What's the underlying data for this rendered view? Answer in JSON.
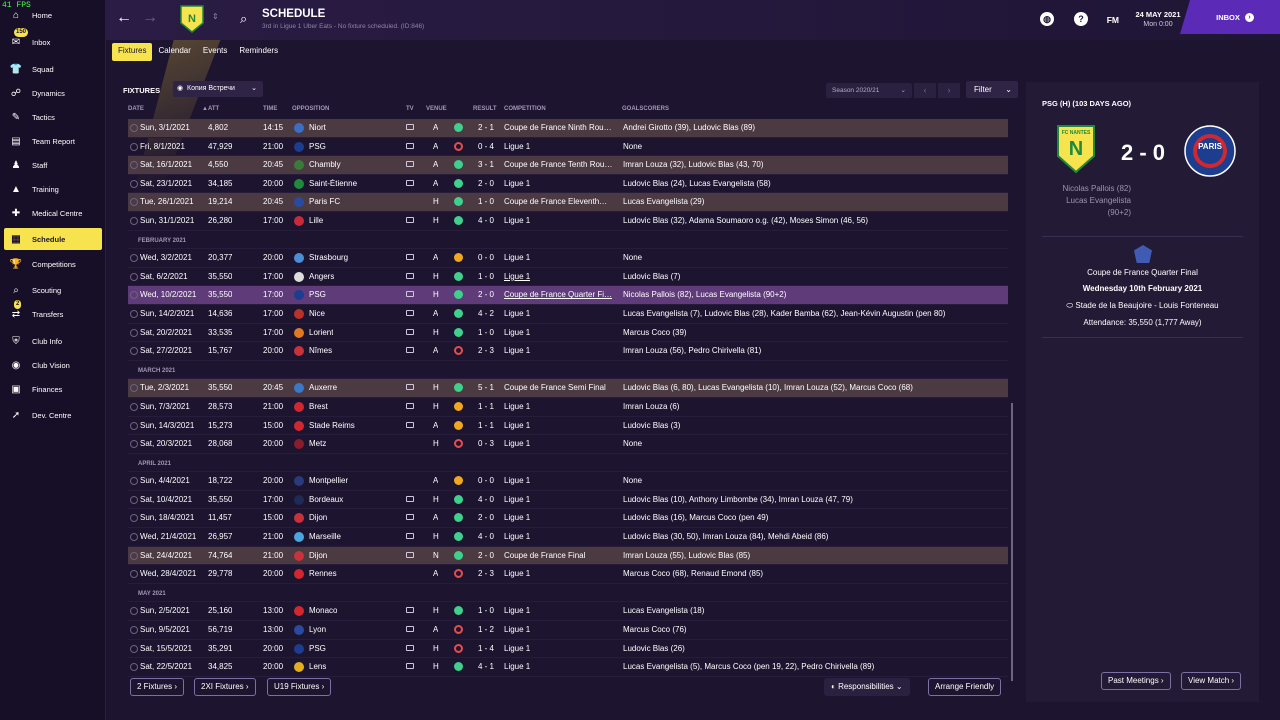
{
  "fps": "41 FPS",
  "sidebar": {
    "items": [
      {
        "label": "Home",
        "icon": "home-icon",
        "glyph": "⌂"
      },
      {
        "label": "Inbox",
        "icon": "inbox-icon",
        "glyph": "✉",
        "badge": "150"
      },
      {
        "label": "Squad",
        "icon": "squad-icon",
        "glyph": "👕"
      },
      {
        "label": "Dynamics",
        "icon": "dynamics-icon",
        "glyph": "☍"
      },
      {
        "label": "Tactics",
        "icon": "tactics-icon",
        "glyph": "✎"
      },
      {
        "label": "Team Report",
        "icon": "report-icon",
        "glyph": "▤"
      },
      {
        "label": "Staff",
        "icon": "staff-icon",
        "glyph": "♟"
      },
      {
        "label": "Training",
        "icon": "training-icon",
        "glyph": "▲"
      },
      {
        "label": "Medical Centre",
        "icon": "medical-icon",
        "glyph": "✚"
      },
      {
        "label": "Schedule",
        "icon": "schedule-icon",
        "glyph": "▦"
      },
      {
        "label": "Competitions",
        "icon": "trophy-icon",
        "glyph": "🏆"
      },
      {
        "label": "Scouting",
        "icon": "scouting-icon",
        "glyph": "⌕"
      },
      {
        "label": "Transfers",
        "icon": "transfers-icon",
        "glyph": "⇄",
        "badge": "2"
      },
      {
        "label": "Club Info",
        "icon": "club-info-icon",
        "glyph": "⛨"
      },
      {
        "label": "Club Vision",
        "icon": "club-vision-icon",
        "glyph": "◉"
      },
      {
        "label": "Finances",
        "icon": "finances-icon",
        "glyph": "▣"
      },
      {
        "label": "Dev. Centre",
        "icon": "dev-centre-icon",
        "glyph": "➚"
      }
    ]
  },
  "header": {
    "title": "SCHEDULE",
    "subtitle": "3rd in Ligue 1 Uber Eats - No fixture scheduled. (ID:846)",
    "fm": "FM",
    "date": "24 MAY 2021",
    "time": "Mon 0:00",
    "inbox": "INBOX"
  },
  "tabs": [
    "Fixtures",
    "Calendar",
    "Events",
    "Reminders"
  ],
  "fixtures": {
    "title": "FIXTURES",
    "view": "Копия Встречи",
    "season": "Season 2020/21",
    "filter": "Filter",
    "columns": {
      "date": "DATE",
      "att": "ATT",
      "time": "TIME",
      "opposition": "OPPOSITION",
      "tv": "TV",
      "venue": "VENUE",
      "result": "RESULT",
      "competition": "COMPETITION",
      "goalscorers": "GOALSCORERS"
    },
    "rows": [
      {
        "date": "Sun, 3/1/2021",
        "att": "4,802",
        "time": "14:15",
        "opp": "Niort",
        "tv": true,
        "venue": "A",
        "res": "W",
        "score": "2 - 1",
        "comp": "Coupe de France Ninth Rou…",
        "goals": "Andrei Girotto (39), Ludovic Blas (89)",
        "cup": true,
        "crest": "#3b6fc4"
      },
      {
        "date": "Fri, 8/1/2021",
        "att": "47,929",
        "time": "21:00",
        "opp": "PSG",
        "tv": true,
        "venue": "A",
        "res": "L",
        "score": "0 - 4",
        "comp": "Ligue 1",
        "goals": "None",
        "crest": "#1d3d8f"
      },
      {
        "date": "Sat, 16/1/2021",
        "att": "4,550",
        "time": "20:45",
        "opp": "Chambly",
        "tv": true,
        "venue": "A",
        "res": "W",
        "score": "3 - 1",
        "comp": "Coupe de France Tenth Rou…",
        "goals": "Imran Louza (32), Ludovic Blas (43, 70)",
        "cup": true,
        "crest": "#3a7a3a"
      },
      {
        "date": "Sat, 23/1/2021",
        "att": "34,185",
        "time": "20:00",
        "opp": "Saint-Étienne",
        "tv": true,
        "venue": "A",
        "res": "W",
        "score": "2 - 0",
        "comp": "Ligue 1",
        "goals": "Ludovic Blas (24), Lucas Evangelista (58)",
        "crest": "#1f8a3b"
      },
      {
        "date": "Tue, 26/1/2021",
        "att": "19,214",
        "time": "20:45",
        "opp": "Paris FC",
        "tv": false,
        "venue": "H",
        "res": "W",
        "score": "1 - 0",
        "comp": "Coupe de France Eleventh…",
        "goals": "Lucas Evangelista (29)",
        "cup": true,
        "crest": "#2a4aa0"
      },
      {
        "date": "Sun, 31/1/2021",
        "att": "26,280",
        "time": "17:00",
        "opp": "Lille",
        "tv": true,
        "venue": "H",
        "res": "W",
        "score": "4 - 0",
        "comp": "Ligue 1",
        "goals": "Ludovic Blas (32), Adama Soumaoro o.g. (42), Moses Simon (46, 56)",
        "crest": "#c82a3a"
      },
      {
        "month": "FEBRUARY 2021"
      },
      {
        "date": "Wed, 3/2/2021",
        "att": "20,377",
        "time": "20:00",
        "opp": "Strasbourg",
        "tv": true,
        "venue": "A",
        "res": "D",
        "score": "0 - 0",
        "comp": "Ligue 1",
        "goals": "None",
        "crest": "#4a8ed6"
      },
      {
        "date": "Sat, 6/2/2021",
        "att": "35,550",
        "time": "17:00",
        "opp": "Angers",
        "tv": true,
        "venue": "H",
        "res": "W",
        "score": "1 - 0",
        "comp": "Ligue 1",
        "goals": "Ludovic Blas (7)",
        "crest": "#dddddd"
      },
      {
        "date": "Wed, 10/2/2021",
        "att": "35,550",
        "time": "17:00",
        "opp": "PSG",
        "tv": true,
        "venue": "H",
        "res": "W",
        "score": "2 - 0",
        "comp": "Coupe de France Quarter Fi…",
        "goals": "Nicolas Pallois (82), Lucas Evangelista (90+2)",
        "sel": true,
        "crest": "#1d3d8f"
      },
      {
        "date": "Sun, 14/2/2021",
        "att": "14,636",
        "time": "17:00",
        "opp": "Nice",
        "tv": true,
        "venue": "A",
        "res": "W",
        "score": "4 - 2",
        "comp": "Ligue 1",
        "goals": "Lucas Evangelista (7), Ludovic Blas (28), Kader Bamba (62), Jean-Kévin Augustin (pen 80)",
        "crest": "#b8322a"
      },
      {
        "date": "Sat, 20/2/2021",
        "att": "33,535",
        "time": "17:00",
        "opp": "Lorient",
        "tv": true,
        "venue": "H",
        "res": "W",
        "score": "1 - 0",
        "comp": "Ligue 1",
        "goals": "Marcus Coco (39)",
        "crest": "#e07a22"
      },
      {
        "date": "Sat, 27/2/2021",
        "att": "15,767",
        "time": "20:00",
        "opp": "Nîmes",
        "tv": true,
        "venue": "A",
        "res": "L",
        "score": "2 - 3",
        "comp": "Ligue 1",
        "goals": "Imran Louza (56), Pedro Chirivella (81)",
        "crest": "#c8323a"
      },
      {
        "month": "MARCH 2021"
      },
      {
        "date": "Tue, 2/3/2021",
        "att": "35,550",
        "time": "20:45",
        "opp": "Auxerre",
        "tv": true,
        "venue": "H",
        "res": "W",
        "score": "5 - 1",
        "comp": "Coupe de France Semi Final",
        "goals": "Ludovic Blas (6, 80), Lucas Evangelista (10), Imran Louza (52), Marcus Coco (68)",
        "cup": true,
        "crest": "#3a78c8"
      },
      {
        "date": "Sun, 7/3/2021",
        "att": "28,573",
        "time": "21:00",
        "opp": "Brest",
        "tv": true,
        "venue": "H",
        "res": "D",
        "score": "1 - 1",
        "comp": "Ligue 1",
        "goals": "Imran Louza (6)",
        "crest": "#d0282e"
      },
      {
        "date": "Sun, 14/3/2021",
        "att": "15,273",
        "time": "15:00",
        "opp": "Stade Reims",
        "tv": true,
        "venue": "A",
        "res": "D",
        "score": "1 - 1",
        "comp": "Ligue 1",
        "goals": "Ludovic Blas (3)",
        "crest": "#d0282e"
      },
      {
        "date": "Sat, 20/3/2021",
        "att": "28,068",
        "time": "20:00",
        "opp": "Metz",
        "tv": false,
        "venue": "H",
        "res": "L",
        "score": "0 - 3",
        "comp": "Ligue 1",
        "goals": "None",
        "crest": "#8a1c2c"
      },
      {
        "month": "APRIL 2021"
      },
      {
        "date": "Sun, 4/4/2021",
        "att": "18,722",
        "time": "20:00",
        "opp": "Montpellier",
        "tv": false,
        "venue": "A",
        "res": "D",
        "score": "0 - 0",
        "comp": "Ligue 1",
        "goals": "None",
        "crest": "#2a3a7a"
      },
      {
        "date": "Sat, 10/4/2021",
        "att": "35,550",
        "time": "17:00",
        "opp": "Bordeaux",
        "tv": true,
        "venue": "H",
        "res": "W",
        "score": "4 - 0",
        "comp": "Ligue 1",
        "goals": "Ludovic Blas (10), Anthony Limbombe (34), Imran Louza (47, 79)",
        "crest": "#1f2a55"
      },
      {
        "date": "Sun, 18/4/2021",
        "att": "11,457",
        "time": "15:00",
        "opp": "Dijon",
        "tv": true,
        "venue": "A",
        "res": "W",
        "score": "2 - 0",
        "comp": "Ligue 1",
        "goals": "Ludovic Blas (16), Marcus Coco (pen 49)",
        "crest": "#c8323a"
      },
      {
        "date": "Wed, 21/4/2021",
        "att": "26,957",
        "time": "21:00",
        "opp": "Marseille",
        "tv": true,
        "venue": "H",
        "res": "W",
        "score": "4 - 0",
        "comp": "Ligue 1",
        "goals": "Ludovic Blas (30, 50), Imran Louza (84), Mehdi Abeid (86)",
        "crest": "#4aa6de"
      },
      {
        "date": "Sat, 24/4/2021",
        "att": "74,764",
        "time": "21:00",
        "opp": "Dijon",
        "tv": true,
        "venue": "N",
        "res": "W",
        "score": "2 - 0",
        "comp": "Coupe de France Final",
        "goals": "Imran Louza (55), Ludovic Blas (85)",
        "cup": true,
        "crest": "#c8323a"
      },
      {
        "date": "Wed, 28/4/2021",
        "att": "29,778",
        "time": "20:00",
        "opp": "Rennes",
        "tv": false,
        "venue": "A",
        "res": "L",
        "score": "2 - 3",
        "comp": "Ligue 1",
        "goals": "Marcus Coco (68), Renaud Emond (85)",
        "crest": "#d0282e"
      },
      {
        "month": "MAY 2021"
      },
      {
        "date": "Sun, 2/5/2021",
        "att": "25,160",
        "time": "13:00",
        "opp": "Monaco",
        "tv": true,
        "venue": "H",
        "res": "W",
        "score": "1 - 0",
        "comp": "Ligue 1",
        "goals": "Lucas Evangelista (18)",
        "crest": "#d0282e"
      },
      {
        "date": "Sun, 9/5/2021",
        "att": "56,719",
        "time": "13:00",
        "opp": "Lyon",
        "tv": true,
        "venue": "A",
        "res": "L",
        "score": "1 - 2",
        "comp": "Ligue 1",
        "goals": "Marcus Coco (76)",
        "crest": "#2a4aa0"
      },
      {
        "date": "Sat, 15/5/2021",
        "att": "35,291",
        "time": "20:00",
        "opp": "PSG",
        "tv": true,
        "venue": "H",
        "res": "L",
        "score": "1 - 4",
        "comp": "Ligue 1",
        "goals": "Ludovic Blas (26)",
        "crest": "#1d3d8f"
      },
      {
        "date": "Sat, 22/5/2021",
        "att": "34,825",
        "time": "20:00",
        "opp": "Lens",
        "tv": true,
        "venue": "H",
        "res": "W",
        "score": "4 - 1",
        "comp": "Ligue 1",
        "goals": "Lucas Evangelista (5), Marcus Coco (pen 19, 22), Pedro Chirivella (89)",
        "crest": "#e0b020"
      }
    ],
    "buttons": {
      "fixtures": "2 Fixtures",
      "xi": "2XI Fixtures",
      "u19": "U19 Fixtures",
      "responsibilities": "Responsibilities",
      "arrange": "Arrange Friendly"
    }
  },
  "match_panel": {
    "title": "PSG (H) (103 DAYS AGO)",
    "score": "2 - 0",
    "home_badge_text": "FC NANTES",
    "away_badge_text": "PARIS",
    "scorers": [
      "Nicolas Pallois (82)",
      "Lucas Evangelista",
      "(90+2)"
    ],
    "competition": "Coupe de France Quarter Final",
    "date": "Wednesday 10th February 2021",
    "stadium": "Stade de la Beaujoire - Louis Fonteneau",
    "attendance": "Attendance: 35,550 (1,777 Away)",
    "past_meetings": "Past Meetings",
    "view_match": "View Match"
  },
  "colors": {
    "accent": "#f6e34d",
    "win": "#3fd08d",
    "draw": "#f2a81e",
    "loss": "#e64d4d",
    "inbox": "#5b2bb7"
  }
}
